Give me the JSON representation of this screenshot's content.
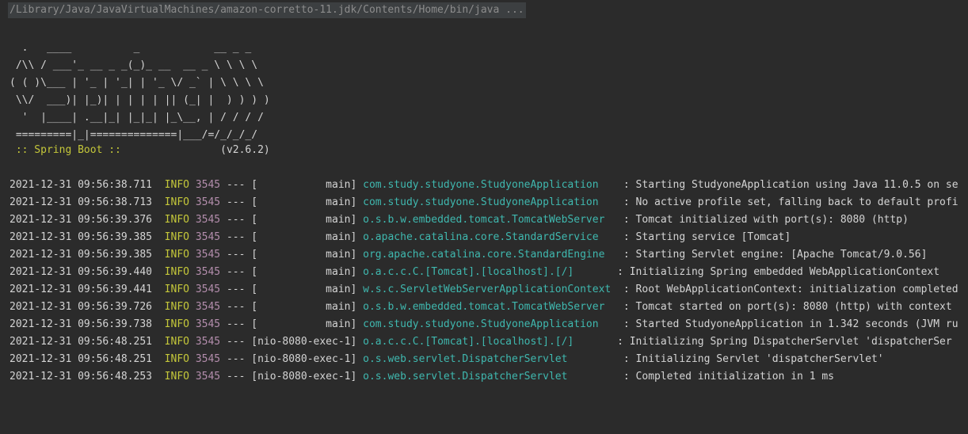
{
  "command": "/Library/Java/JavaVirtualMachines/amazon-corretto-11.jdk/Contents/Home/bin/java ...",
  "banner": [
    "  .   ____          _            __ _ _",
    " /\\\\ / ___'_ __ _ _(_)_ __  __ _ \\ \\ \\ \\",
    "( ( )\\___ | '_ | '_| | '_ \\/ _` | \\ \\ \\ \\",
    " \\\\/  ___)| |_)| | | | | || (_| |  ) ) ) )",
    "  '  |____| .__|_| |_|_| |_\\__, | / / / /",
    " =========|_|==============|___/=/_/_/_/"
  ],
  "boot": {
    "label": " :: Spring Boot :: ",
    "version": "               (v2.6.2)"
  },
  "logs": [
    {
      "ts": "2021-12-31 09:56:38.711",
      "level": "INFO",
      "pid": "3545",
      "sep": "---",
      "thread": "[           main]",
      "logger": "com.study.studyone.StudyoneApplication   ",
      "msg": ": Starting StudyoneApplication using Java 11.0.5 on se"
    },
    {
      "ts": "2021-12-31 09:56:38.713",
      "level": "INFO",
      "pid": "3545",
      "sep": "---",
      "thread": "[           main]",
      "logger": "com.study.studyone.StudyoneApplication   ",
      "msg": ": No active profile set, falling back to default profi"
    },
    {
      "ts": "2021-12-31 09:56:39.376",
      "level": "INFO",
      "pid": "3545",
      "sep": "---",
      "thread": "[           main]",
      "logger": "o.s.b.w.embedded.tomcat.TomcatWebServer  ",
      "msg": ": Tomcat initialized with port(s): 8080 (http)"
    },
    {
      "ts": "2021-12-31 09:56:39.385",
      "level": "INFO",
      "pid": "3545",
      "sep": "---",
      "thread": "[           main]",
      "logger": "o.apache.catalina.core.StandardService   ",
      "msg": ": Starting service [Tomcat]"
    },
    {
      "ts": "2021-12-31 09:56:39.385",
      "level": "INFO",
      "pid": "3545",
      "sep": "---",
      "thread": "[           main]",
      "logger": "org.apache.catalina.core.StandardEngine  ",
      "msg": ": Starting Servlet engine: [Apache Tomcat/9.0.56]"
    },
    {
      "ts": "2021-12-31 09:56:39.440",
      "level": "INFO",
      "pid": "3545",
      "sep": "---",
      "thread": "[           main]",
      "logger": "o.a.c.c.C.[Tomcat].[localhost].[/]      ",
      "msg": ": Initializing Spring embedded WebApplicationContext"
    },
    {
      "ts": "2021-12-31 09:56:39.441",
      "level": "INFO",
      "pid": "3545",
      "sep": "---",
      "thread": "[           main]",
      "logger": "w.s.c.ServletWebServerApplicationContext ",
      "msg": ": Root WebApplicationContext: initialization completed"
    },
    {
      "ts": "2021-12-31 09:56:39.726",
      "level": "INFO",
      "pid": "3545",
      "sep": "---",
      "thread": "[           main]",
      "logger": "o.s.b.w.embedded.tomcat.TomcatWebServer  ",
      "msg": ": Tomcat started on port(s): 8080 (http) with context"
    },
    {
      "ts": "2021-12-31 09:56:39.738",
      "level": "INFO",
      "pid": "3545",
      "sep": "---",
      "thread": "[           main]",
      "logger": "com.study.studyone.StudyoneApplication   ",
      "msg": ": Started StudyoneApplication in 1.342 seconds (JVM ru"
    },
    {
      "ts": "2021-12-31 09:56:48.251",
      "level": "INFO",
      "pid": "3545",
      "sep": "---",
      "thread": "[nio-8080-exec-1]",
      "logger": "o.a.c.c.C.[Tomcat].[localhost].[/]      ",
      "msg": ": Initializing Spring DispatcherServlet 'dispatcherSer"
    },
    {
      "ts": "2021-12-31 09:56:48.251",
      "level": "INFO",
      "pid": "3545",
      "sep": "---",
      "thread": "[nio-8080-exec-1]",
      "logger": "o.s.web.servlet.DispatcherServlet        ",
      "msg": ": Initializing Servlet 'dispatcherServlet'"
    },
    {
      "ts": "2021-12-31 09:56:48.253",
      "level": "INFO",
      "pid": "3545",
      "sep": "---",
      "thread": "[nio-8080-exec-1]",
      "logger": "o.s.web.servlet.DispatcherServlet        ",
      "msg": ": Completed initialization in 1 ms"
    }
  ],
  "colors": {
    "background": "#2b2b2b",
    "level": "#c4c73a",
    "pid": "#b48ead",
    "logger": "#3fb8af",
    "text": "#d4d4d4"
  }
}
